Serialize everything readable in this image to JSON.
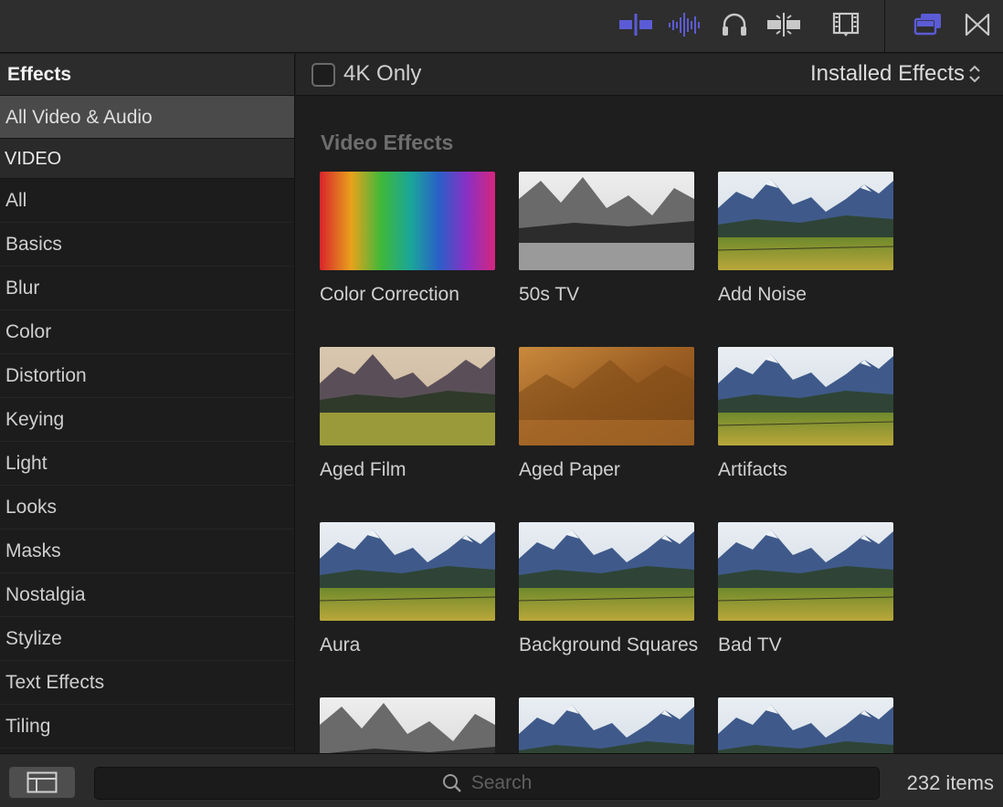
{
  "toolbar": {
    "icons": [
      "clip-skimming-icon",
      "audio-skimming-icon",
      "headphones-icon",
      "snapping-icon",
      "filmstrip-icon",
      "window-icon",
      "transitions-icon"
    ]
  },
  "sidebar": {
    "header": "Effects",
    "selected": "All Video & Audio",
    "section": "VIDEO",
    "items": [
      "All",
      "Basics",
      "Blur",
      "Color",
      "Distortion",
      "Keying",
      "Light",
      "Looks",
      "Masks",
      "Nostalgia",
      "Stylize",
      "Text Effects",
      "Tiling"
    ]
  },
  "browser": {
    "filter_label": "4K Only",
    "filter_checked": false,
    "dropdown_label": "Installed Effects",
    "section_title": "Video Effects",
    "effects": [
      {
        "label": "Color Correction",
        "thumb": "rainbow"
      },
      {
        "label": "50s TV",
        "thumb": "bw"
      },
      {
        "label": "Add Noise",
        "thumb": "landscape"
      },
      {
        "label": "Aged Film",
        "thumb": "aged"
      },
      {
        "label": "Aged Paper",
        "thumb": "sepia"
      },
      {
        "label": "Artifacts",
        "thumb": "landscape"
      },
      {
        "label": "Aura",
        "thumb": "landscape"
      },
      {
        "label": "Background Squares",
        "thumb": "landscape"
      },
      {
        "label": "Bad TV",
        "thumb": "landscape"
      },
      {
        "label": "",
        "thumb": "bw"
      },
      {
        "label": "",
        "thumb": "landscape"
      },
      {
        "label": "",
        "thumb": "landscape"
      }
    ]
  },
  "bottom": {
    "search_placeholder": "Search",
    "item_count": "232 items"
  },
  "colors": {
    "accent": "#5b5bd6",
    "icon_gray": "#c8c8c8"
  }
}
